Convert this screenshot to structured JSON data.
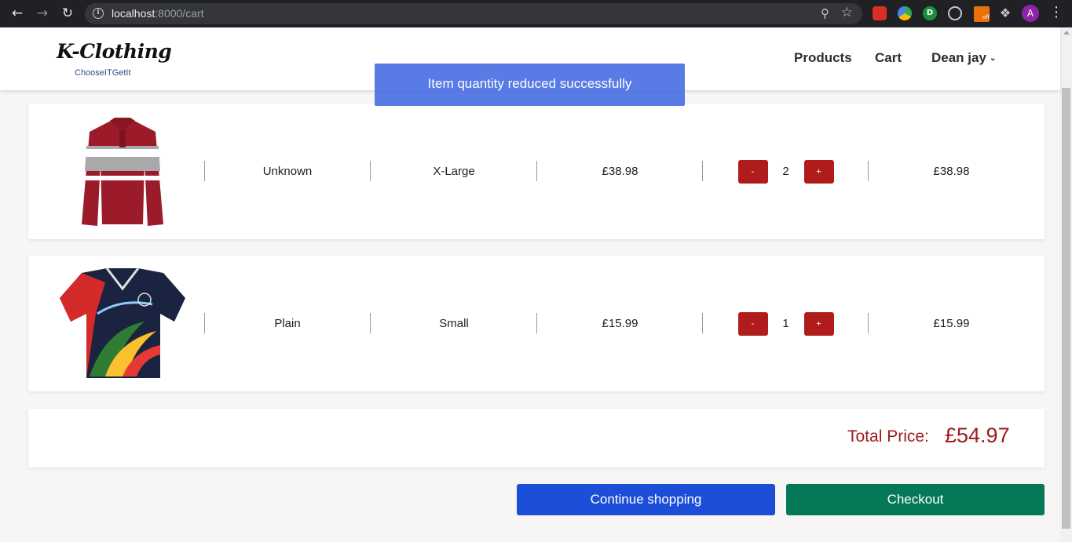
{
  "browser": {
    "back_icon": "arrow-left-icon",
    "forward_icon": "arrow-right-icon",
    "reload_icon": "reload-icon",
    "url_host": "localhost",
    "url_rest": ":8000/cart",
    "avatar_letter": "A",
    "pdf_ext_badge": "off"
  },
  "header": {
    "logo_title": "K-Clothing",
    "logo_tagline": "ChooseITGetIt",
    "nav": {
      "products": "Products",
      "cart": "Cart",
      "user": "Dean jay"
    }
  },
  "toast": {
    "message": "Item quantity reduced successfully",
    "color": "#4169e1"
  },
  "cart": {
    "items": [
      {
        "description": "Unknown",
        "size": "X-Large",
        "price": "£38.98",
        "quantity": "2",
        "line_total": "£38.98",
        "minus_label": "-",
        "plus_label": "+"
      },
      {
        "description": "Plain",
        "size": "Small",
        "price": "£15.99",
        "quantity": "1",
        "line_total": "£15.99",
        "minus_label": "-",
        "plus_label": "+"
      }
    ],
    "total_label": "Total Price:",
    "total_value": "£54.97"
  },
  "actions": {
    "continue_label": "Continue shopping",
    "checkout_label": "Checkout"
  },
  "colors": {
    "accent_red": "#b01c1c",
    "continue_blue": "#1d4ed8",
    "checkout_green": "#047857"
  }
}
